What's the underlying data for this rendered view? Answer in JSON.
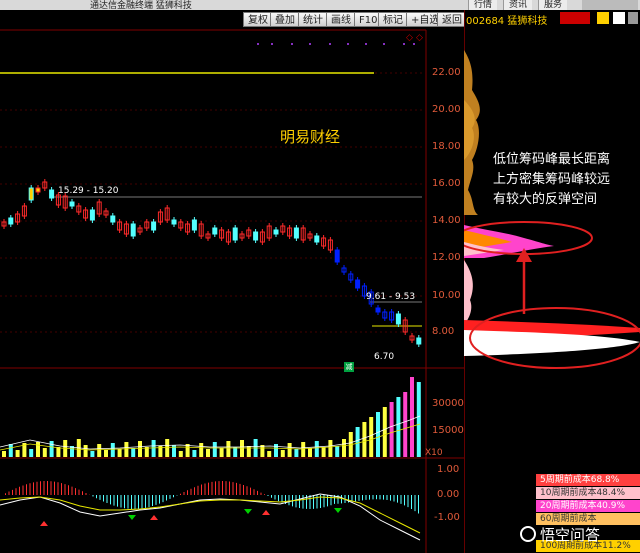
{
  "window": {
    "title": "通达信金融终端  猛狮科技",
    "menu": [
      "行情",
      "资讯",
      "服务"
    ]
  },
  "toolbar": {
    "buttons": [
      "复权",
      "叠加",
      "统计",
      "画线",
      "F10",
      "标记",
      "+自选",
      "返回"
    ]
  },
  "stock": {
    "code_name": "002684 猛狮科技"
  },
  "price_axis": [
    "22.00",
    "20.00",
    "18.00",
    "16.00",
    "14.00",
    "12.00",
    "10.00",
    "8.00"
  ],
  "volume_axis": [
    "30000",
    "15000",
    "X10"
  ],
  "macd_axis": [
    "1.00",
    "0.00",
    "-1.00"
  ],
  "annotations": {
    "high_range": "15.29 - 15.20",
    "mid_range": "9.61 - 9.53",
    "low_price": "6.70",
    "watermark": "明易财经",
    "note_line1": "低位筹码峰最长距离",
    "note_line2": "上方密集筹码峰较远",
    "note_line3": "有较大的反弹空间"
  },
  "cost_rows": [
    {
      "label": "5周期前成本68.8%",
      "color": "#ff4040",
      "text_color": "#fff"
    },
    {
      "label": "10周期前成本48.4%",
      "color": "#ffc0cb",
      "text_color": "#333"
    },
    {
      "label": "20周期前成本40.9%",
      "color": "#ff44cc",
      "text_color": "#fff"
    },
    {
      "label": "60周期前成本",
      "color": "#ffc060",
      "text_color": "#333"
    },
    {
      "label": "100周期前成本11.2%",
      "color": "#ffd000",
      "text_color": "#333"
    }
  ],
  "logo": {
    "text": "悟空问答",
    "icon": "wukong-logo-icon"
  }
}
